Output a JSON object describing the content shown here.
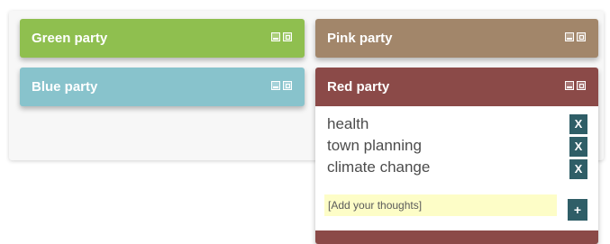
{
  "panels": {
    "green": {
      "title": "Green party"
    },
    "pink": {
      "title": "Pink party"
    },
    "blue": {
      "title": "Blue party"
    },
    "red": {
      "title": "Red party",
      "topics": [
        "health",
        "town planning",
        "climate change"
      ],
      "remove_label": "X",
      "thoughts_placeholder": "[Add your thoughts]",
      "add_label": "+"
    }
  },
  "colors": {
    "green": "#8fbf4f",
    "pink": "#a2866a",
    "blue": "#88c3cc",
    "red": "#8b4a48",
    "button": "#2f5e67",
    "input_bg": "#fdfdc7"
  },
  "icons": [
    "minimize-icon",
    "maximize-icon"
  ]
}
